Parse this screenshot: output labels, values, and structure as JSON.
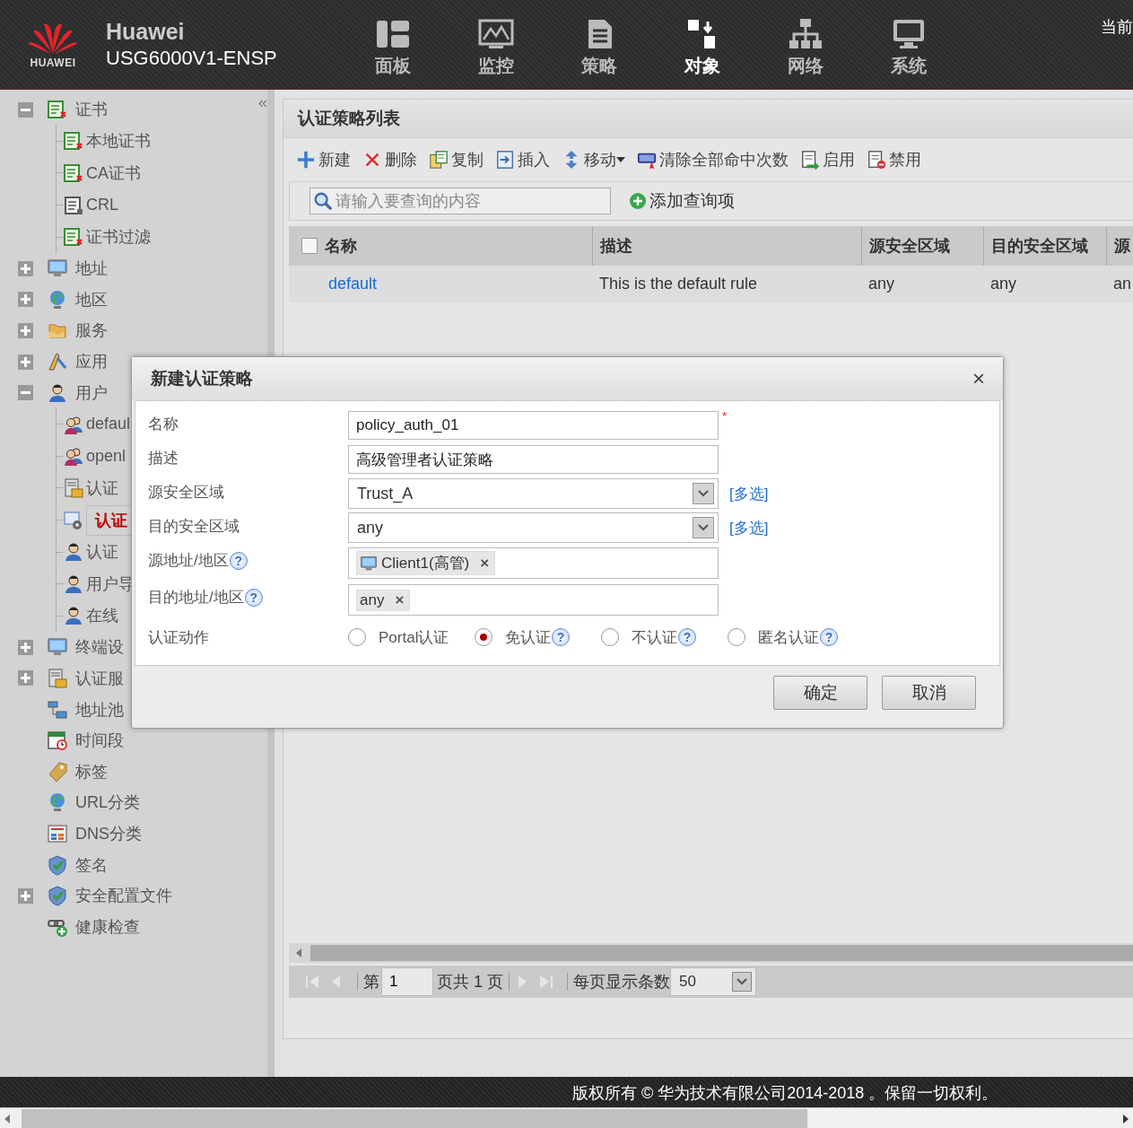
{
  "header": {
    "logo_text": "HUAWEI",
    "brand": "Huawei",
    "model": "USG6000V1-ENSP",
    "corner_text": "当前",
    "nav": [
      {
        "label": "面板",
        "selected": false
      },
      {
        "label": "监控",
        "selected": false
      },
      {
        "label": "策略",
        "selected": false
      },
      {
        "label": "对象",
        "selected": true
      },
      {
        "label": "网络",
        "selected": false
      },
      {
        "label": "系统",
        "selected": false
      }
    ]
  },
  "sidebar": {
    "collapse_glyph": "«",
    "items": [
      {
        "label": "证书",
        "expanded": true,
        "selected": false,
        "children": [
          {
            "label": "本地证书",
            "selected": false
          },
          {
            "label": "CA证书",
            "selected": false
          },
          {
            "label": "CRL",
            "selected": false
          },
          {
            "label": "证书过滤",
            "selected": false
          }
        ]
      },
      {
        "label": "地址",
        "expanded": false,
        "selected": false
      },
      {
        "label": "地区",
        "expanded": false,
        "selected": false
      },
      {
        "label": "服务",
        "expanded": false,
        "selected": false
      },
      {
        "label": "应用",
        "expanded": false,
        "selected": false
      },
      {
        "label": "用户",
        "expanded": true,
        "selected": false,
        "children": [
          {
            "label": "defaul",
            "selected": false
          },
          {
            "label": "openl",
            "selected": false
          },
          {
            "label": "认证",
            "selected": false
          },
          {
            "label": "认证",
            "selected": true
          },
          {
            "label": "认证",
            "selected": false
          },
          {
            "label": "用户导",
            "selected": false
          },
          {
            "label": "在线",
            "selected": false
          }
        ]
      },
      {
        "label": "终端设",
        "expanded": false,
        "selected": false
      },
      {
        "label": "认证服",
        "expanded": false,
        "selected": false
      },
      {
        "label": "地址池",
        "selected": false
      },
      {
        "label": "时间段",
        "selected": false
      },
      {
        "label": "标签",
        "selected": false
      },
      {
        "label": "URL分类",
        "selected": false
      },
      {
        "label": "DNS分类",
        "selected": false
      },
      {
        "label": "签名",
        "selected": false
      },
      {
        "label": "安全配置文件",
        "expanded": false,
        "selected": false
      },
      {
        "label": "健康检查",
        "selected": false
      }
    ]
  },
  "panel": {
    "title": "认证策略列表",
    "toolbar": [
      {
        "label": "新建"
      },
      {
        "label": "删除"
      },
      {
        "label": "复制"
      },
      {
        "label": "插入"
      },
      {
        "label": "移动",
        "dropdown": true
      },
      {
        "label": "清除全部命中次数"
      },
      {
        "label": "启用"
      },
      {
        "label": "禁用"
      }
    ],
    "search": {
      "placeholder": "请输入要查询的内容"
    },
    "add_query": "添加查询项",
    "table": {
      "select_all": {
        "checked": false
      },
      "columns": [
        "名称",
        "描述",
        "源安全区域",
        "目的安全区域",
        "源"
      ],
      "rows": [
        {
          "cells": [
            "default",
            "This is the default rule",
            "any",
            "any",
            "an"
          ]
        }
      ]
    },
    "pager": {
      "buttons": [
        {
          "kind": "first",
          "disabled": true
        },
        {
          "kind": "prev",
          "disabled": true
        },
        {
          "kind": "next",
          "disabled": true
        },
        {
          "kind": "last",
          "disabled": true
        }
      ],
      "page_label": "第",
      "page": "1",
      "total_label": "页共 1 页",
      "size_label": "每页显示条数",
      "size": "50"
    }
  },
  "dialog": {
    "title": "新建认证策略",
    "close": "×",
    "fields": [
      {
        "kind": "text",
        "label": "名称",
        "value": "policy_auth_01",
        "required_mark": "*"
      },
      {
        "kind": "text",
        "label": "描述",
        "value": "高级管理者认证策略"
      },
      {
        "kind": "select",
        "label": "源安全区域",
        "value": "Trust_A",
        "link": "[多选]"
      },
      {
        "kind": "select",
        "label": "目的安全区域",
        "value": "any",
        "link": "[多选]"
      },
      {
        "kind": "tags",
        "label": "源地址/地区",
        "help": "?",
        "tags": [
          {
            "label": "Client1(高管)",
            "kind": "host",
            "remove": "×"
          }
        ]
      },
      {
        "kind": "tags",
        "label": "目的地址/地区",
        "help": "?",
        "tags": [
          {
            "label": "any",
            "remove": "×"
          }
        ]
      },
      {
        "kind": "radios",
        "label": "认证动作",
        "options": [
          {
            "label": "Portal认证",
            "selected": false
          },
          {
            "label": "免认证",
            "selected": true,
            "help": "?"
          },
          {
            "label": "不认证",
            "selected": false,
            "help": "?"
          },
          {
            "label": "匿名认证",
            "selected": false,
            "help": "?"
          }
        ]
      }
    ],
    "buttons": [
      "确定",
      "取消"
    ]
  },
  "footer": "版权所有 © 华为技术有限公司2014-2018 。保留一切权利。"
}
